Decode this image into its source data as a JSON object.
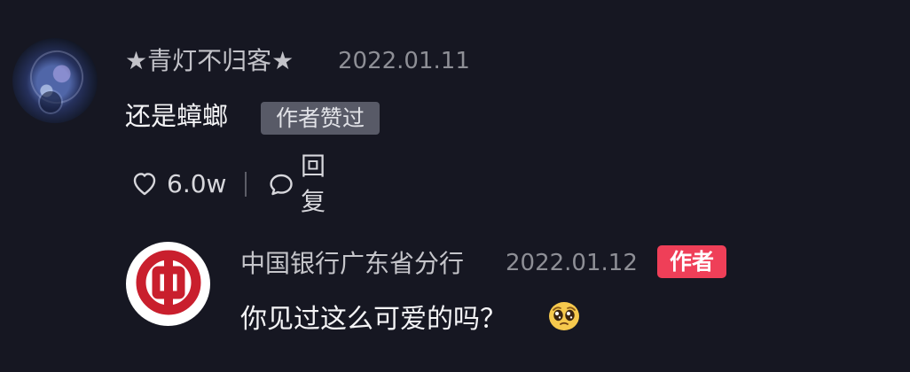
{
  "comment": {
    "username": "★青灯不归客★",
    "timestamp": "2022.01.11",
    "text": "还是蟑螂",
    "author_liked_badge": "作者赞过",
    "like_count": "6.0w",
    "reply_label": "回复",
    "avatar_icon": "profile-avatar-icon"
  },
  "reply": {
    "author_name": "中国银行广东省分行",
    "timestamp": "2022.01.12",
    "author_badge": "作者",
    "text": "你见过这么可爱的吗？",
    "avatar_icon": "bank-logo-icon",
    "emoji_icon": "pleading-face-icon"
  },
  "colors": {
    "background": "#161722",
    "primary_text": "#f4f4f6",
    "secondary_text": "#8e8f96",
    "liked_badge_bg": "#585a67",
    "author_badge_bg": "#ef3f58",
    "bank_red": "#c91f2d"
  }
}
